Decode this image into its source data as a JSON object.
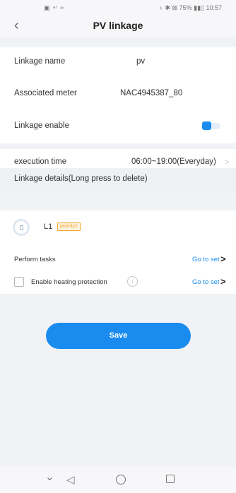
{
  "status_bar": {
    "left_icons": "▣ ᵊˡ ≈",
    "right_text": "♁ ✱ ⊠ 75% ▮▮▯ 10:57"
  },
  "header": {
    "back_icon": "‹",
    "title": "PV linkage"
  },
  "fields": {
    "linkage_name_label": "Linkage name",
    "linkage_name_value": "pv",
    "associated_meter_label": "Associated meter",
    "associated_meter_value": "NAC4945387_80",
    "linkage_enable_label": "Linkage enable",
    "linkage_enable_on": true,
    "execution_time_label": "execution time",
    "execution_time_value": "06:00~19:00(Everyday)",
    "execution_chevron": ">"
  },
  "linkage_details": {
    "header": "Linkage details(Long press to delete)",
    "item_label": "L1",
    "priority_badge": "priority1",
    "perform_tasks_label": "Perform tasks",
    "perform_tasks_link": "Go to set",
    "heating_protection_label": "Enable heating protection",
    "heating_protection_link": "Go to set",
    "heating_protection_checked": false,
    "info_icon": "i",
    "chevron": ">"
  },
  "actions": {
    "save_label": "Save"
  },
  "bottom_nav": {
    "down_icon": "⌄",
    "back_icon": "◁"
  },
  "colors": {
    "accent": "#1a8cf0",
    "badge": "#f5a623",
    "background": "#f1f2f6"
  }
}
